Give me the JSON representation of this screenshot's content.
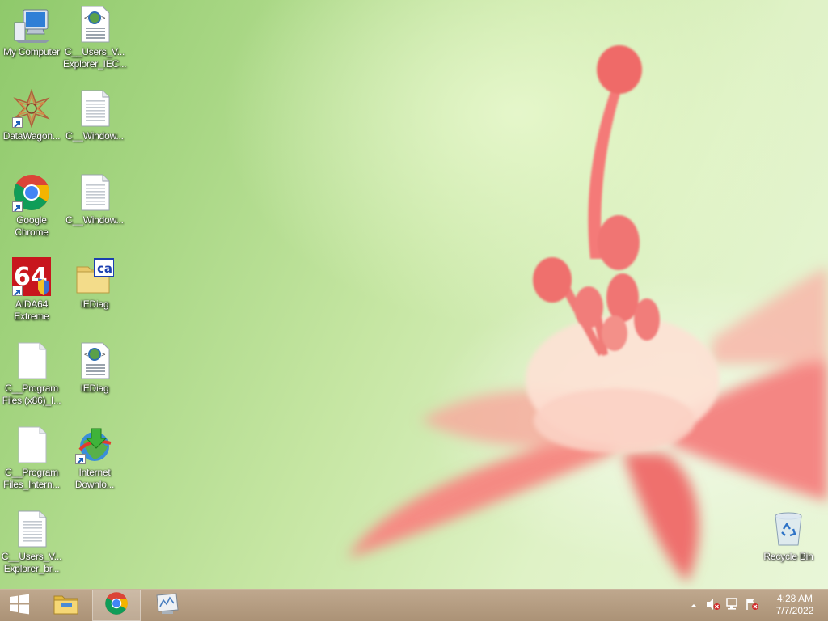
{
  "desktop": {
    "icons": [
      {
        "label": "My Computer",
        "icon": "computer-icon"
      },
      {
        "label": "C__Users_V...\nExplorer_IEC...",
        "icon": "web-document-icon"
      },
      {
        "label": "DataWagon...",
        "icon": "datawagon-icon"
      },
      {
        "label": "C__Window...",
        "icon": "text-document-icon"
      },
      {
        "label": "Google\nChrome",
        "icon": "chrome-icon"
      },
      {
        "label": "C__Window...",
        "icon": "text-document-icon"
      },
      {
        "label": "AIDA64\nExtreme",
        "icon": "aida64-icon"
      },
      {
        "label": "IEDiag",
        "icon": "folder-icon"
      },
      {
        "label": "C__Program\nFiles (x86)_I...",
        "icon": "blank-document-icon"
      },
      {
        "label": "IEDiag",
        "icon": "web-document-icon"
      },
      {
        "label": "C__Program\nFiles_Intern...",
        "icon": "blank-document-icon"
      },
      {
        "label": "Internet\nDownlo...",
        "icon": "internet-download-manager-icon"
      },
      {
        "label": "C__Users_V...\nExplorer_br...",
        "icon": "text-document-icon"
      },
      {
        "label": "Recycle Bin",
        "icon": "recycle-bin-icon"
      }
    ]
  },
  "taskbar": {
    "start_icon": "windows-logo-icon",
    "pinned": [
      {
        "name": "file-explorer",
        "icon": "file-explorer-icon"
      },
      {
        "name": "google-chrome",
        "icon": "chrome-icon",
        "active": true
      },
      {
        "name": "performance-monitor",
        "icon": "monitor-app-icon"
      }
    ],
    "tray": {
      "icons": [
        "show-hidden-icons-arrow",
        "volume-muted-icon",
        "network-icon",
        "action-center-flag-icon"
      ],
      "time": "4:28 AM",
      "date": "7/7/2022"
    }
  },
  "colors": {
    "wallpaper_green": "#a7d683",
    "flower_pink": "#f27a78",
    "taskbar": "#b49b80"
  }
}
